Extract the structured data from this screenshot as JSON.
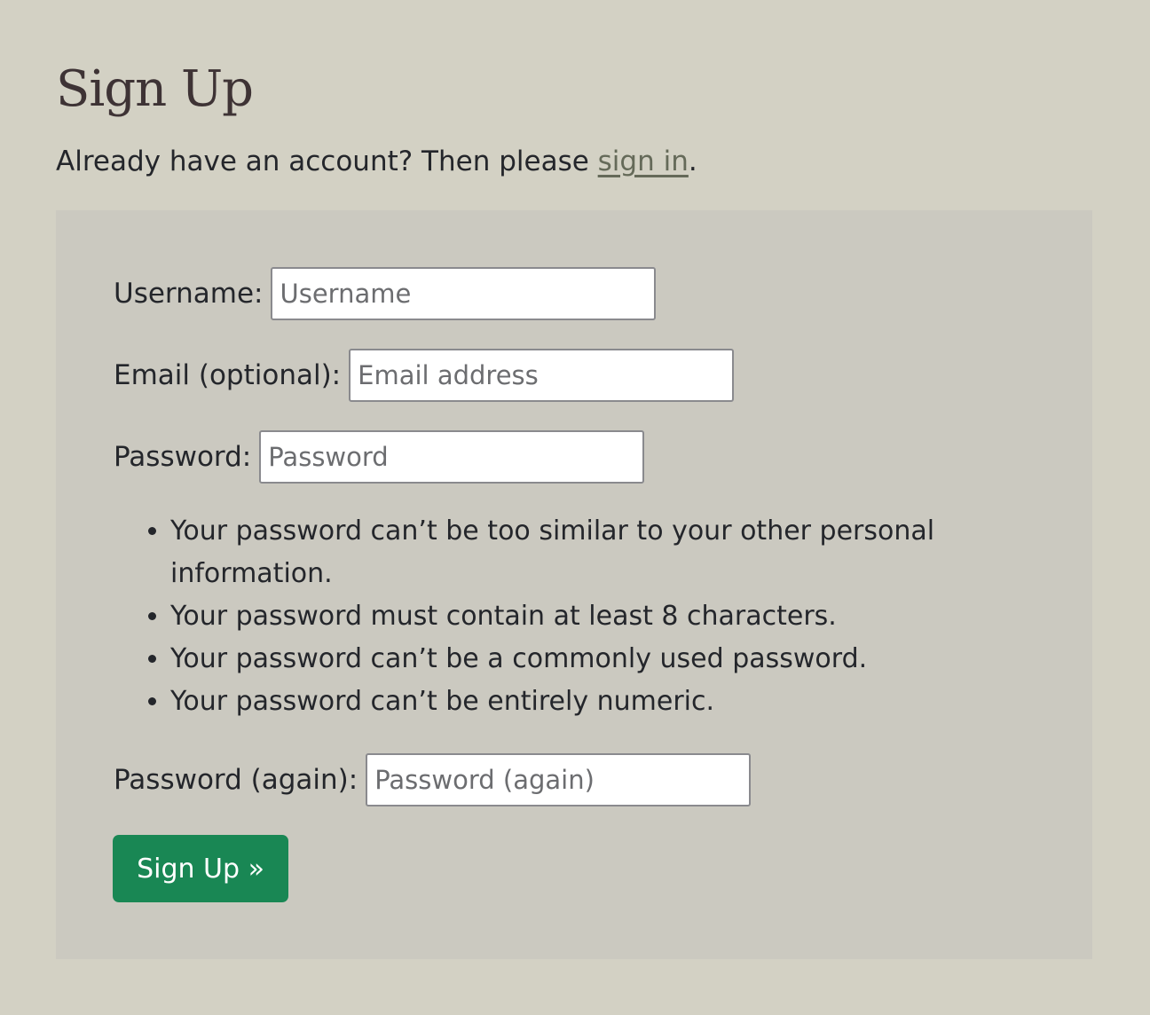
{
  "page": {
    "title": "Sign Up",
    "intro_text": "Already have an account? Then please ",
    "signin_link": "sign in",
    "intro_suffix": "."
  },
  "form": {
    "username": {
      "label": "Username:",
      "placeholder": "Username",
      "value": ""
    },
    "email": {
      "label": "Email (optional):",
      "placeholder": "Email address",
      "value": ""
    },
    "password": {
      "label": "Password:",
      "placeholder": "Password",
      "value": ""
    },
    "password_help": [
      "Your password can’t be too similar to your other personal information.",
      "Your password must contain at least 8 characters.",
      "Your password can’t be a commonly used password.",
      "Your password can’t be entirely numeric."
    ],
    "password_again": {
      "label": "Password (again):",
      "placeholder": "Password (again)",
      "value": ""
    },
    "submit_label": "Sign Up »"
  },
  "colors": {
    "background": "#d3d1c4",
    "panel": "#cbc9c0",
    "title": "#3e3335",
    "link": "#656a59",
    "button": "#198754"
  }
}
